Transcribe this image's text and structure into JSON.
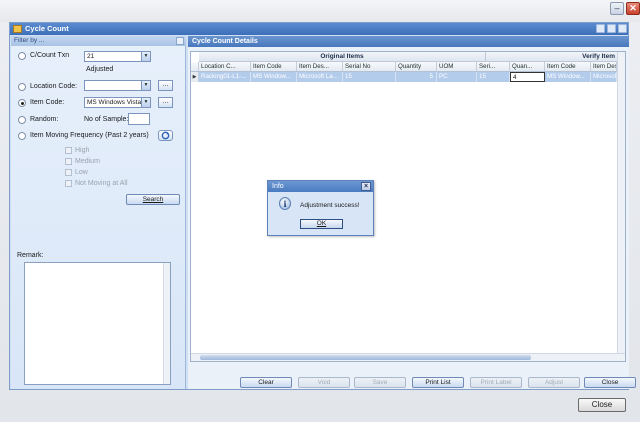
{
  "window": {
    "title": "Cycle Count",
    "outer_close_label": "Close"
  },
  "filter": {
    "header": "Filter by ...",
    "cc_txn": {
      "label": "C/Count Txn",
      "value": "21",
      "status": "Adjusted"
    },
    "location_code": {
      "label": "Location Code:",
      "value": ""
    },
    "item_code": {
      "label": "Item Code:",
      "value": "MS Windows Vista"
    },
    "random": {
      "label": "Random:",
      "sample_label": "No of Sample:",
      "sample_value": ""
    },
    "moving_freq": {
      "label": "Item Moving Frequency (Past 2 years)"
    },
    "freq_options": [
      "High",
      "Medium",
      "Low",
      "Not Moving at All"
    ],
    "search_label": "Search",
    "remark_label": "Remark:",
    "selected_radio": "item_code"
  },
  "details": {
    "header": "Cycle Count Details",
    "group_original": "Original Items",
    "group_verify": "Verify Item",
    "columns": [
      "Location C...",
      "Item Code",
      "Item Des...",
      "Serial No",
      "Quantity",
      "UOM",
      "Seri...",
      "Quan...",
      "Item Code",
      "Item Descr"
    ],
    "row": [
      "Racking01-L1-...",
      "MS Window...",
      "Microsoft La...",
      "15",
      "5",
      "PC",
      "15",
      "4",
      "MS Window...",
      "Microsoft La..."
    ]
  },
  "actions": {
    "clear": "Clear",
    "void": "Void",
    "save": "Save",
    "print_list": "Print List",
    "print_label": "Print Label",
    "adjust": "Adjust",
    "close": "Close"
  },
  "dialog": {
    "title": "Info",
    "icon": "info-icon",
    "message": "Adjustment success!",
    "ok": "OK"
  },
  "icons": {
    "refresh": "refresh-icon",
    "minimize": "minimize-icon",
    "close": "close-icon"
  },
  "colors": {
    "title_bar": "#4a7bc0",
    "grid_selection": "#b4ccec",
    "panel_bg": "#cfe0f5"
  }
}
